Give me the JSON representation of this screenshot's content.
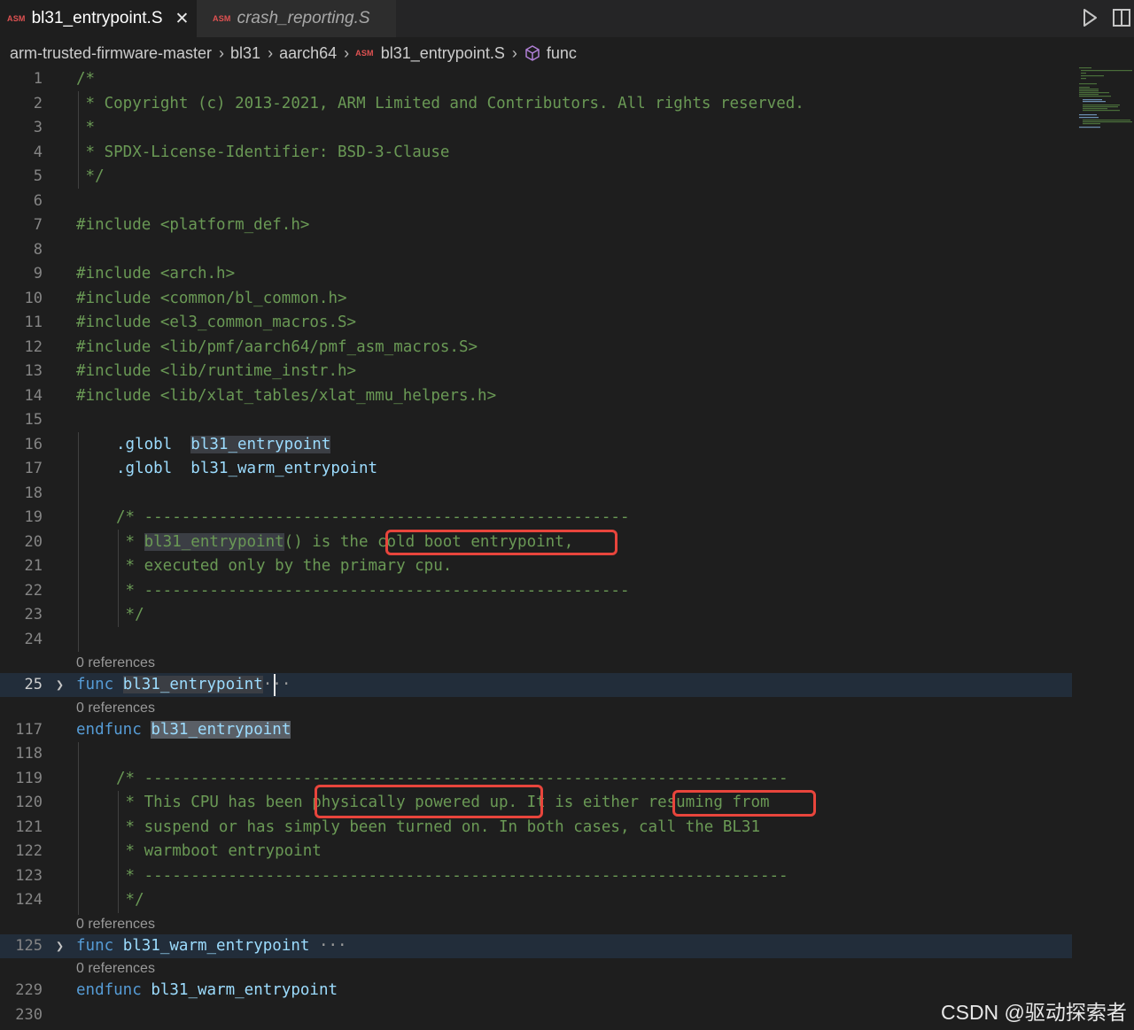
{
  "tabs": [
    {
      "badge": "ASM",
      "label": "bl31_entrypoint.S",
      "active": true
    },
    {
      "badge": "ASM",
      "label": "crash_reporting.S",
      "active": false
    }
  ],
  "breadcrumb": {
    "items": [
      "arm-trusted-firmware-master",
      "bl31",
      "aarch64"
    ],
    "file_badge": "ASM",
    "file": "bl31_entrypoint.S",
    "symbol": "func"
  },
  "code_lens": "0 references",
  "watermark": "CSDN @驱动探索者",
  "colors": {
    "comment": "#6a9955",
    "keyword": "#569cd6",
    "highlight_box": "#e8453c",
    "background": "#1e1e1e"
  },
  "lines": [
    {
      "n": "1"
    },
    {
      "n": "2"
    },
    {
      "n": "3"
    },
    {
      "n": "4"
    },
    {
      "n": "5"
    },
    {
      "n": "6"
    },
    {
      "n": "7"
    },
    {
      "n": "8"
    },
    {
      "n": "9"
    },
    {
      "n": "10"
    },
    {
      "n": "11"
    },
    {
      "n": "12"
    },
    {
      "n": "13"
    },
    {
      "n": "14"
    },
    {
      "n": "15"
    },
    {
      "n": "16"
    },
    {
      "n": "17"
    },
    {
      "n": "18"
    },
    {
      "n": "19"
    },
    {
      "n": "20"
    },
    {
      "n": "21"
    },
    {
      "n": "22"
    },
    {
      "n": "23"
    },
    {
      "n": "24"
    },
    {
      "n": "25"
    },
    {
      "n": "117"
    },
    {
      "n": "118"
    },
    {
      "n": "119"
    },
    {
      "n": "120"
    },
    {
      "n": "121"
    },
    {
      "n": "122"
    },
    {
      "n": "123"
    },
    {
      "n": "124"
    },
    {
      "n": "125"
    },
    {
      "n": "229"
    },
    {
      "n": "230"
    }
  ],
  "code": {
    "l1": "/*",
    "l2": " * Copyright (c) 2013-2021, ARM Limited and Contributors. All rights reserved.",
    "l3": " *",
    "l4": " * SPDX-License-Identifier: BSD-3-Clause",
    "l5": " */",
    "l7": "#include <platform_def.h>",
    "l9": "#include <arch.h>",
    "l10": "#include <common/bl_common.h>",
    "l11": "#include <el3_common_macros.S>",
    "l12": "#include <lib/pmf/aarch64/pmf_asm_macros.S>",
    "l13": "#include <lib/runtime_instr.h>",
    "l14": "#include <lib/xlat_tables/xlat_mmu_helpers.h>",
    "l16_dir": ".globl",
    "l16_sym": "bl31_entrypoint",
    "l17_dir": ".globl",
    "l17_sym": "bl31_warm_entrypoint",
    "l19": "/* ----------------------------------------------------",
    "l20_a": " * ",
    "l20_sym": "bl31_entrypoint",
    "l20_b": "() is the ",
    "l20_c": "cold boot entrypoint,",
    "l21": " * executed only by the primary cpu.",
    "l22": " * ----------------------------------------------------",
    "l23": " */",
    "l25_kw": "func",
    "l25_sym": "bl31_entrypoint",
    "l25_more": "···",
    "l117_kw": "endfunc",
    "l117_sym": "bl31_entrypoint",
    "l119": "/* ---------------------------------------------------------------------",
    "l120_a": " * This CPU has been ",
    "l120_b": "physically powered up.",
    "l120_c": " It is either ",
    "l120_d": "resuming from",
    "l121": " * suspend or has simply been turned on. In both cases, call the BL31",
    "l122": " * warmboot entrypoint",
    "l123": " * ---------------------------------------------------------------------",
    "l124": " */",
    "l125_kw": "func",
    "l125_sym": "bl31_warm_entrypoint",
    "l125_more": "···",
    "l229_kw": "endfunc",
    "l229_sym": "bl31_warm_entrypoint"
  }
}
